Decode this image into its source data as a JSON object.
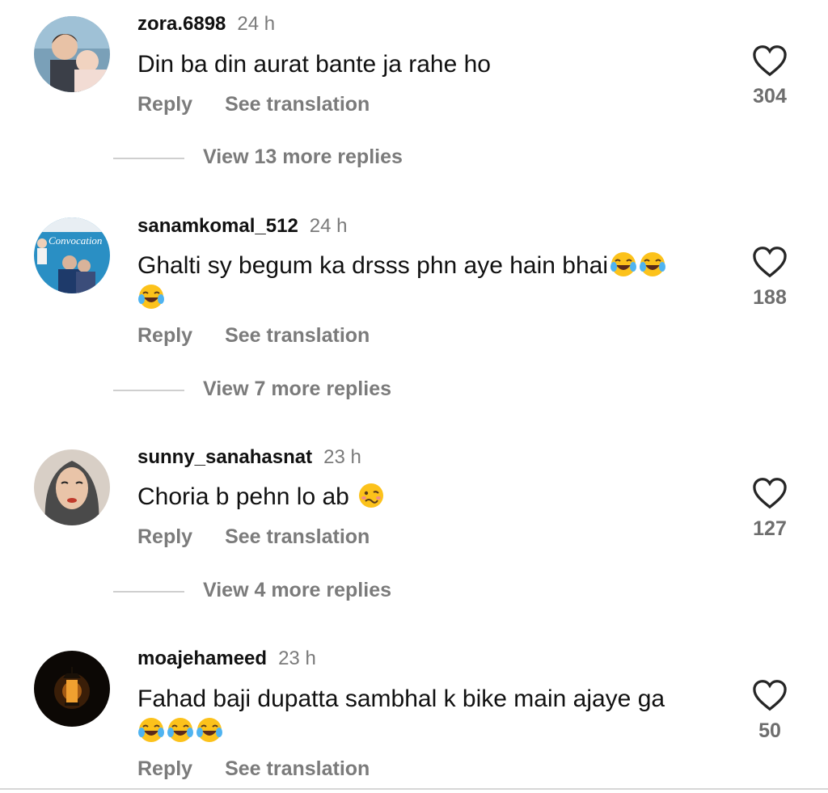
{
  "comments": [
    {
      "username": "zora.6898",
      "time": "24 h",
      "text": "Din ba din aurat bante ja rahe ho",
      "emojis": [],
      "emoji_line2": [],
      "likes": "304",
      "reply_label": "Reply",
      "translate_label": "See translation",
      "more_replies": "View 13 more replies",
      "avatar_icon": "avatar-children-photo"
    },
    {
      "username": "sanamkomal_512",
      "time": "24 h",
      "text": "Ghalti sy begum ka drsss phn aye hain bhai",
      "emojis": [
        "laughing-tears",
        "laughing-tears"
      ],
      "emoji_line2": [
        "laughing-tears"
      ],
      "likes": "188",
      "reply_label": "Reply",
      "translate_label": "See translation",
      "more_replies": "View 7 more replies",
      "avatar_icon": "avatar-convocation-photo",
      "avatar_text": "Convocation"
    },
    {
      "username": "sunny_sanahasnat",
      "time": "23 h",
      "text": "Choria b pehn lo ab",
      "emojis": [
        "woozy-face"
      ],
      "emoji_line2": [],
      "likes": "127",
      "reply_label": "Reply",
      "translate_label": "See translation",
      "more_replies": "View 4 more replies",
      "avatar_icon": "avatar-illustrated-woman"
    },
    {
      "username": "moajehameed",
      "time": "23 h",
      "text": "Fahad baji dupatta sambhal k bike main ajaye ga",
      "emojis": [],
      "emoji_line2": [
        "laughing-tears",
        "laughing-tears",
        "laughing-tears"
      ],
      "likes": "50",
      "reply_label": "Reply",
      "translate_label": "See translation",
      "more_replies": "",
      "avatar_icon": "avatar-lantern-photo"
    }
  ],
  "colors": {
    "text": "#111111",
    "secondary": "#7b7b7b",
    "divider": "#cfcfcf",
    "emoji_yellow": "#fcc21b"
  }
}
